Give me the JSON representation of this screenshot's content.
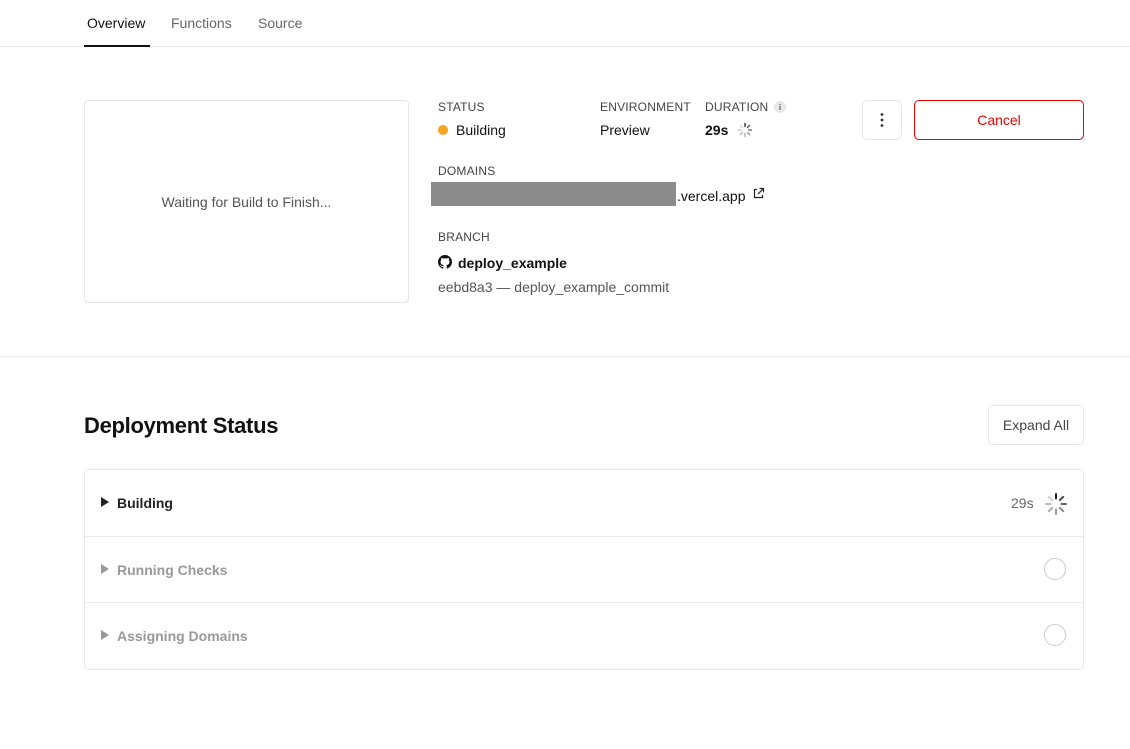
{
  "tabs": [
    {
      "label": "Overview",
      "active": true
    },
    {
      "label": "Functions",
      "active": false
    },
    {
      "label": "Source",
      "active": false
    }
  ],
  "preview": {
    "text": "Waiting for Build to Finish..."
  },
  "info": {
    "status_label": "STATUS",
    "status_value": "Building",
    "status_color": "#f5a623",
    "environment_label": "ENVIRONMENT",
    "environment_value": "Preview",
    "duration_label": "DURATION",
    "duration_value": "29s",
    "domains_label": "DOMAINS",
    "domain_suffix": ".vercel.app",
    "branch_label": "BRANCH",
    "branch_name": "deploy_example",
    "commit": "eebd8a3 — deploy_example_commit"
  },
  "actions": {
    "more_icon": "kebab-vertical-icon",
    "cancel_label": "Cancel"
  },
  "deployment": {
    "title": "Deployment Status",
    "expand_label": "Expand All",
    "steps": [
      {
        "label": "Building",
        "time": "29s",
        "state": "in-progress"
      },
      {
        "label": "Running Checks",
        "time": "",
        "state": "pending"
      },
      {
        "label": "Assigning Domains",
        "time": "",
        "state": "pending"
      }
    ]
  },
  "colors": {
    "accent_danger": "#ee0000",
    "building": "#f5a623"
  }
}
